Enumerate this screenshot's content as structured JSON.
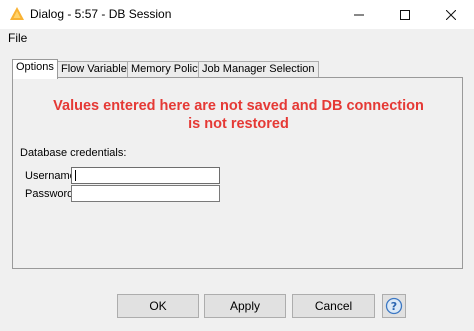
{
  "window": {
    "title": "Dialog - 5:57 - DB Session",
    "app_icon": "knime-triangle-icon",
    "minimize_symbol": "–",
    "maximize_symbol": "☐",
    "close_symbol": "✕"
  },
  "menu": {
    "file_label": "File"
  },
  "tabs": [
    {
      "label": "Options",
      "active": true
    },
    {
      "label": "Flow Variables",
      "active": false
    },
    {
      "label": "Memory Policy",
      "active": false
    },
    {
      "label": "Job Manager Selection",
      "active": false
    }
  ],
  "options": {
    "warning_line1": "Values entered here are not saved and DB connection",
    "warning_line2": "is not restored",
    "warning_color": "#e53935",
    "section_label": "Database credentials:",
    "username_label": "Username",
    "username_value": "",
    "password_label": "Password",
    "password_value": ""
  },
  "buttons": {
    "ok_label": "OK",
    "apply_label": "Apply",
    "cancel_label": "Cancel",
    "help_icon": "help-question-icon"
  }
}
